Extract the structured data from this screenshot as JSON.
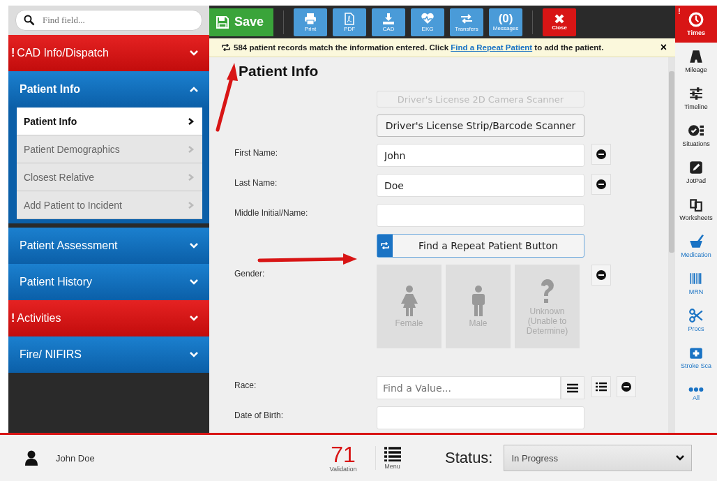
{
  "sidebar": {
    "search": {
      "placeholder": "Find field..."
    },
    "sections": [
      {
        "label": "CAD Info/Dispatch",
        "flag": "!",
        "expanded": false
      },
      {
        "label": "Patient Info",
        "expanded": true,
        "children": [
          {
            "label": "Patient Info",
            "selected": true
          },
          {
            "label": "Patient Demographics",
            "selected": false
          },
          {
            "label": "Closest Relative",
            "selected": false
          },
          {
            "label": "Add Patient to Incident",
            "selected": false
          }
        ]
      },
      {
        "label": "Patient Assessment",
        "expanded": false
      },
      {
        "label": "Patient History",
        "expanded": false
      },
      {
        "label": "Activities",
        "flag": "!",
        "expanded": false
      },
      {
        "label": "Fire/ NIFIRS",
        "expanded": false
      }
    ]
  },
  "toolbar": [
    {
      "kind": "save",
      "label": "Save"
    },
    {
      "kind": "tool",
      "label": "Print"
    },
    {
      "kind": "tool",
      "label": "PDF"
    },
    {
      "kind": "tool",
      "label": "CAD"
    },
    {
      "kind": "tool",
      "label": "EKG"
    },
    {
      "kind": "tool",
      "label": "Transfers"
    },
    {
      "kind": "count",
      "count": "(0)",
      "label": "Messages"
    },
    {
      "kind": "close",
      "label": "Close"
    }
  ],
  "banner": {
    "before": "584 patient records match the information entered. Click ",
    "link": "Find a Repeat Patient",
    "after": " to add the patient.",
    "close": "×"
  },
  "form": {
    "title": "Patient Info",
    "rows": [
      {
        "kind": "button",
        "label": "Driver's License 2D Camera Scanner",
        "disabled": true
      },
      {
        "kind": "button",
        "label": "Driver's License Strip/Barcode Scanner",
        "disabled": false
      },
      {
        "kind": "text",
        "label": "First Name:",
        "value": "John"
      },
      {
        "kind": "text",
        "label": "Last Name:",
        "value": "Doe"
      },
      {
        "kind": "text",
        "label": "Middle Initial/Name:"
      },
      {
        "kind": "repeat",
        "label": "Find a Repeat Patient Button"
      },
      {
        "kind": "choice",
        "label": "Gender:",
        "options": [
          {
            "label": "Female",
            "selected": false
          },
          {
            "label": "Male",
            "selected": false
          },
          {
            "label": "Unknown (Unable to Determine)",
            "selected": false
          }
        ]
      },
      {
        "kind": "lookup",
        "label": "Race:",
        "placeholder": "Find a Value..."
      },
      {
        "kind": "text",
        "label": "Date of Birth:"
      }
    ]
  },
  "rail": [
    {
      "label": "Times",
      "kind": "alert",
      "flag": "!"
    },
    {
      "label": "Mileage",
      "kind": "record"
    },
    {
      "label": "Timeline",
      "kind": "record"
    },
    {
      "label": "Situations",
      "kind": "record"
    },
    {
      "label": "JotPad",
      "kind": "record"
    },
    {
      "label": "Worksheets",
      "kind": "record"
    },
    {
      "label": "Medication",
      "kind": "clinical"
    },
    {
      "label": "MRN",
      "kind": "clinical"
    },
    {
      "label": "Procs",
      "kind": "clinical"
    },
    {
      "label": "Stroke Sca",
      "kind": "clinical"
    },
    {
      "label": "All",
      "kind": "clinical"
    }
  ],
  "footer": {
    "user": "John Doe",
    "validation_count": "71",
    "validation_label": "Validation",
    "menu_label": "Menu",
    "status_label": "Status:",
    "status_value": "In Progress"
  }
}
